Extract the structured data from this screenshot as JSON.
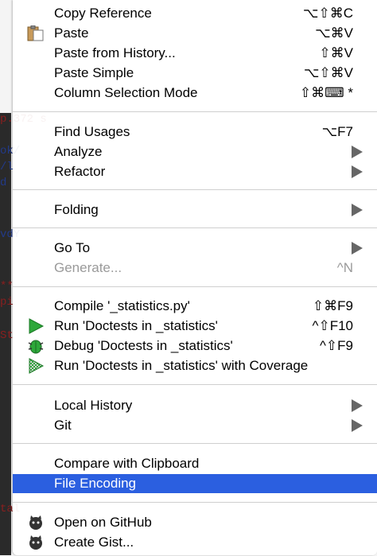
{
  "background_fragments": [
    "p.372 s",
    "ok/",
    "/l",
    "d",
    "vdY",
    "**",
    "pi",
    "St",
    "tal"
  ],
  "menu": [
    {
      "label": "Copy Reference",
      "shortcut": "⌥⇧⌘C",
      "enabled": true
    },
    {
      "label": "Paste",
      "shortcut": "⌥⌘V",
      "enabled": true,
      "icon": "paste-icon"
    },
    {
      "label": "Paste from History...",
      "shortcut": "⇧⌘V",
      "enabled": true
    },
    {
      "label": "Paste Simple",
      "shortcut": "⌥⇧⌘V",
      "enabled": true
    },
    {
      "label": "Column Selection Mode",
      "shortcut": "⇧⌘⌨ *",
      "enabled": true
    },
    {
      "label": "Find Usages",
      "shortcut": "⌥F7",
      "enabled": true
    },
    {
      "label": "Analyze",
      "submenu": true,
      "enabled": true
    },
    {
      "label": "Refactor",
      "submenu": true,
      "enabled": true
    },
    {
      "label": "Folding",
      "submenu": true,
      "enabled": true
    },
    {
      "label": "Go To",
      "submenu": true,
      "enabled": true
    },
    {
      "label": "Generate...",
      "shortcut": "^N",
      "enabled": false
    },
    {
      "label": "Compile '_statistics.py'",
      "shortcut": "⇧⌘F9",
      "enabled": true
    },
    {
      "label": "Run 'Doctests in _statistics'",
      "shortcut": "^⇧F10",
      "enabled": true,
      "icon": "run-icon"
    },
    {
      "label": "Debug 'Doctests in _statistics'",
      "shortcut": "^⇧F9",
      "enabled": true,
      "icon": "debug-icon"
    },
    {
      "label": "Run 'Doctests in _statistics' with Coverage",
      "enabled": true,
      "icon": "coverage-icon"
    },
    {
      "label": "Local History",
      "submenu": true,
      "enabled": true
    },
    {
      "label": "Git",
      "submenu": true,
      "enabled": true
    },
    {
      "label": "Compare with Clipboard",
      "enabled": true
    },
    {
      "label": "File Encoding",
      "enabled": true,
      "selected": true
    },
    {
      "label": "Open on GitHub",
      "enabled": true,
      "icon": "github-icon"
    },
    {
      "label": "Create Gist...",
      "enabled": true,
      "icon": "github-icon"
    }
  ],
  "colors": {
    "selection": "#2b5fe0",
    "run_green": "#2da83a",
    "disabled": "#9a9a9a"
  }
}
